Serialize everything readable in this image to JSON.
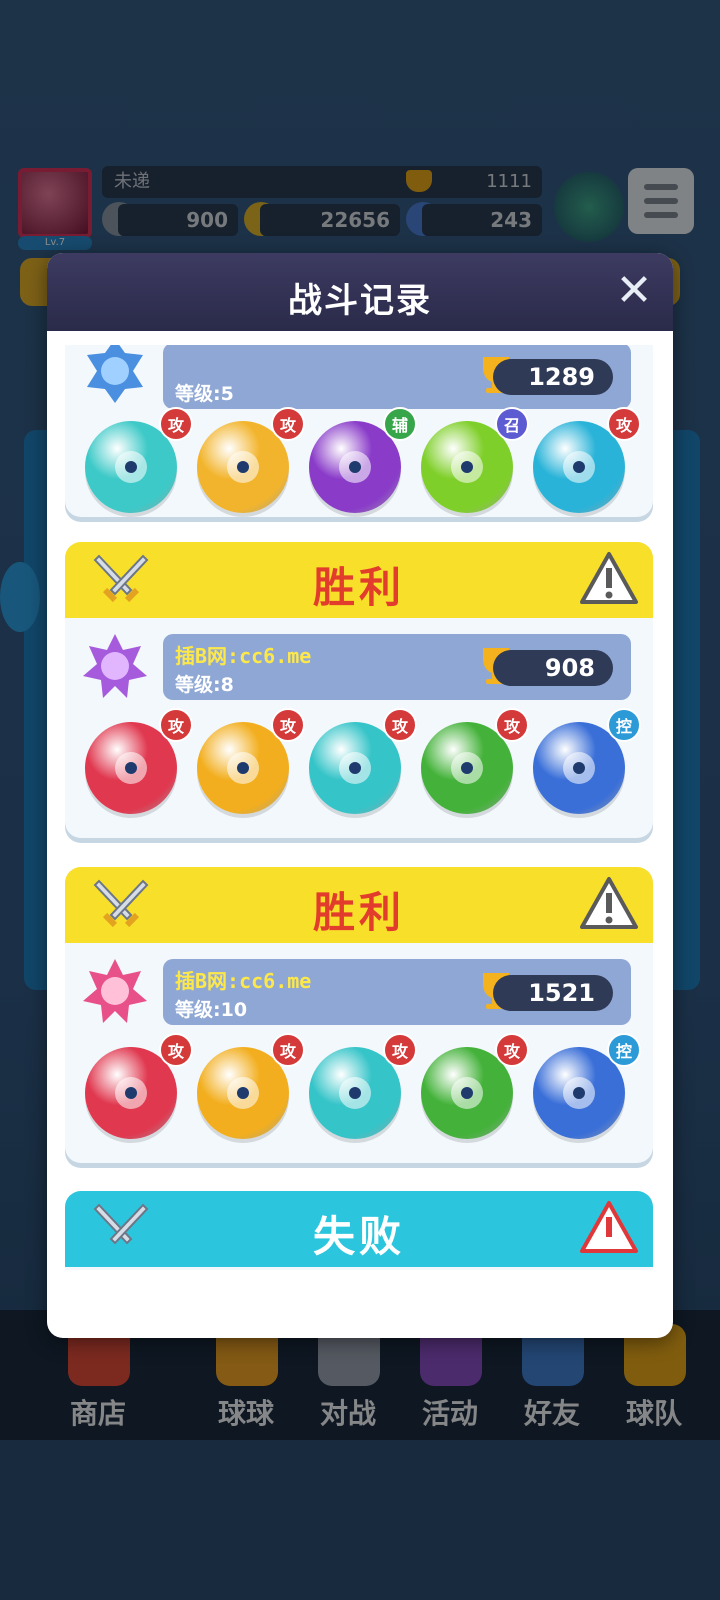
{
  "player": {
    "name": "未递",
    "level": "Lv.7",
    "trophies": "1111",
    "energy": "900",
    "coins": "22656",
    "gems": "243"
  },
  "nav": [
    {
      "label": "商店",
      "icon": "shop-icon"
    },
    {
      "label": "球球",
      "icon": "balls-icon"
    },
    {
      "label": "对战",
      "icon": "battle-icon"
    },
    {
      "label": "活动",
      "icon": "party-popper-icon"
    },
    {
      "label": "好友",
      "icon": "friends-icon"
    },
    {
      "label": "球队",
      "icon": "whistle-icon"
    }
  ],
  "modal": {
    "title": "战斗记录",
    "close": "✕"
  },
  "records": [
    {
      "result": "",
      "opponent": "",
      "level": "等级:5",
      "trophies": "1289",
      "balls": [
        {
          "type": "whirlwind-ball-icon",
          "role": "攻",
          "color": "#3cc9c7"
        },
        {
          "type": "shuriken-ball-icon",
          "role": "攻",
          "color": "#f2b42c"
        },
        {
          "type": "purple-flower-ball-icon",
          "role": "辅",
          "color": "#8a3cc9"
        },
        {
          "type": "radiation-ball-icon",
          "role": "召",
          "color": "#7fcf2a"
        },
        {
          "type": "vortex-ball-icon",
          "role": "攻",
          "color": "#2ab3d8"
        }
      ]
    },
    {
      "result": "胜利",
      "opponent": "插B网:cc6.me",
      "level": "等级:8",
      "trophies": "908",
      "balls": [
        {
          "type": "fire-ball-icon",
          "role": "攻",
          "color": "#e0384f"
        },
        {
          "type": "lightning-ball-icon",
          "role": "攻",
          "color": "#f2ae1e"
        },
        {
          "type": "wind-ball-icon",
          "role": "攻",
          "color": "#35c4c8"
        },
        {
          "type": "poison-skull-ball-icon",
          "role": "攻",
          "color": "#44b23a"
        },
        {
          "type": "ice-ball-icon",
          "role": "控",
          "color": "#3a6fd8"
        }
      ]
    },
    {
      "result": "胜利",
      "opponent": "插B网:cc6.me",
      "level": "等级:10",
      "trophies": "1521",
      "balls": [
        {
          "type": "fire-ball-icon",
          "role": "攻",
          "color": "#e0384f"
        },
        {
          "type": "lightning-ball-icon",
          "role": "攻",
          "color": "#f2ae1e"
        },
        {
          "type": "wind-ball-icon",
          "role": "攻",
          "color": "#35c4c8"
        },
        {
          "type": "poison-skull-ball-icon",
          "role": "攻",
          "color": "#44b23a"
        },
        {
          "type": "ice-ball-icon",
          "role": "控",
          "color": "#3a6fd8"
        }
      ]
    },
    {
      "result": "失败"
    }
  ]
}
